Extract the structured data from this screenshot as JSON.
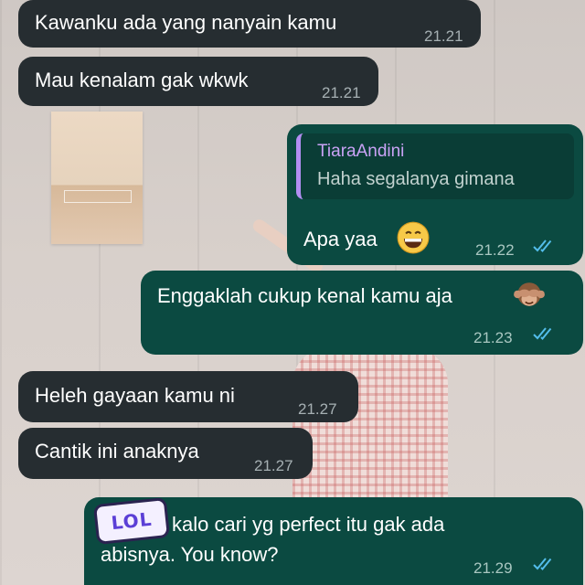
{
  "messages": [
    {
      "id": "m1",
      "direction": "in",
      "text": "Kawanku ada yang nanyain kamu",
      "time": "21.21"
    },
    {
      "id": "m2",
      "direction": "in",
      "text": "Mau kenalam gak wkwk",
      "time": "21.21"
    },
    {
      "id": "m3",
      "direction": "out",
      "quote": {
        "author": "TiaraAndini",
        "text": "Haha segalanya gimana"
      },
      "text": "Apa yaa",
      "emoji": "grinning-face-emoji",
      "time": "21.22",
      "status": "read"
    },
    {
      "id": "m4",
      "direction": "out",
      "text": "Enggaklah cukup kenal kamu aja",
      "emoji": "see-no-evil-monkey-emoji",
      "time": "21.23",
      "status": "read"
    },
    {
      "id": "m5",
      "direction": "in",
      "text": "Heleh gayaan kamu ni",
      "time": "21.27"
    },
    {
      "id": "m6",
      "direction": "in",
      "text": "Cantik ini anaknya",
      "time": "21.27"
    },
    {
      "id": "m7",
      "direction": "out",
      "sticker": "LOL",
      "text_line1": "kalo cari yg perfect itu gak ada",
      "text_line2": "abisnya. You know?",
      "time": "21.29",
      "status": "read"
    }
  ],
  "colors": {
    "incoming_bubble": "#262d31",
    "outgoing_bubble": "#0b4a41",
    "read_ticks": "#53bdeb",
    "quote_author": "#c9a2f5"
  }
}
